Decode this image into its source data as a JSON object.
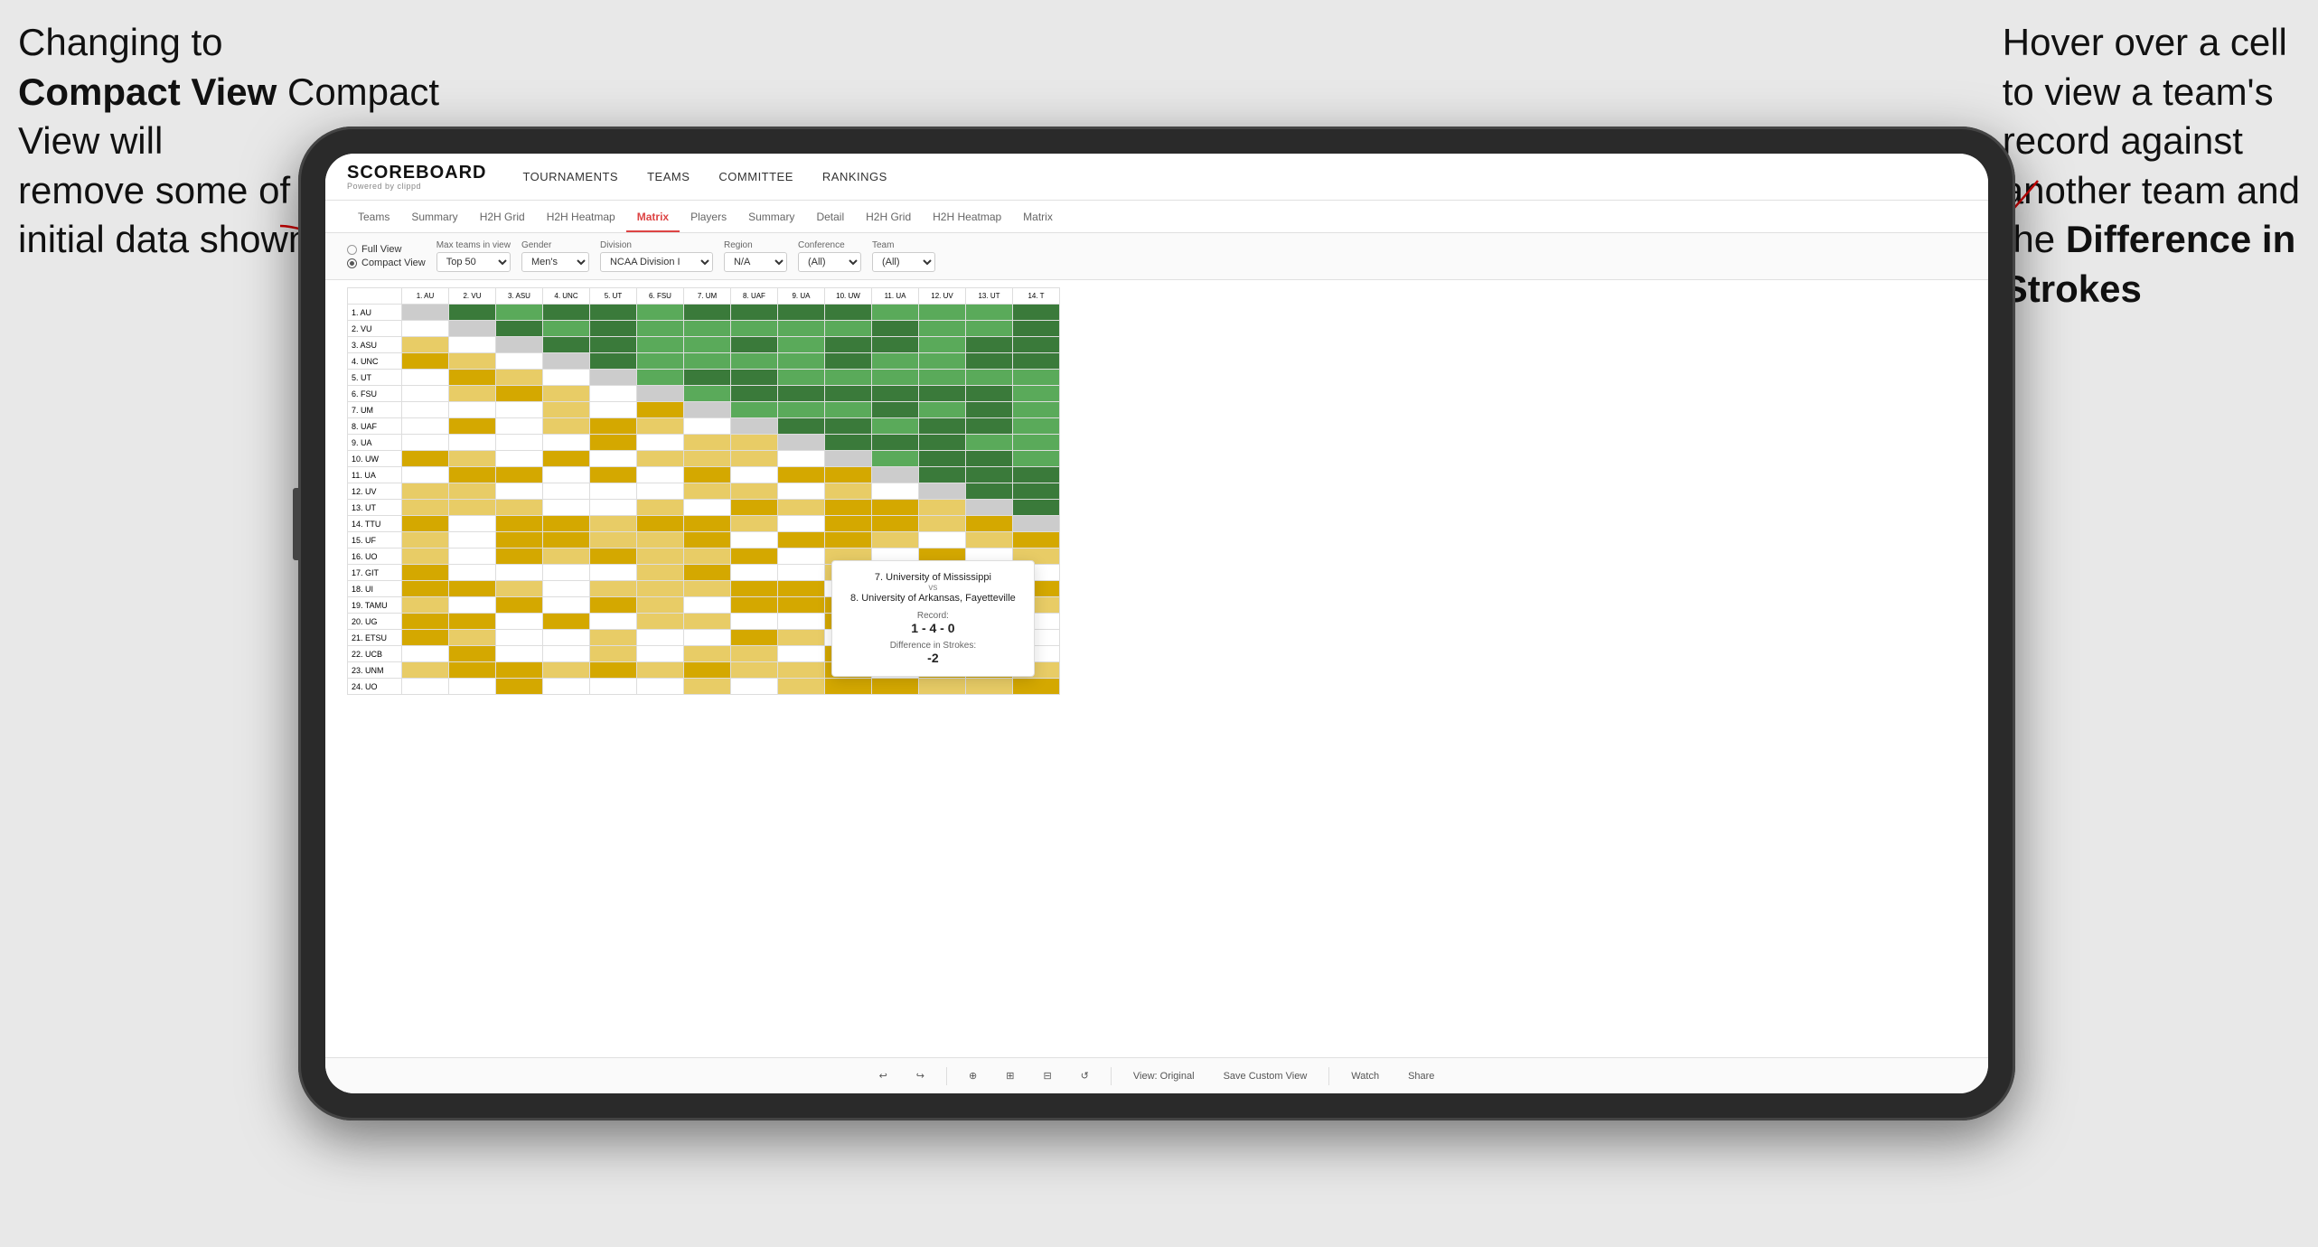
{
  "annotation_left": {
    "line1": "Changing to",
    "line2": "Compact View will",
    "line3": "remove some of the",
    "line4": "initial data shown"
  },
  "annotation_right": {
    "line1": "Hover over a cell",
    "line2": "to view a team's",
    "line3": "record against",
    "line4": "another team and",
    "line5": "the",
    "line6": "Difference in",
    "line7": "Strokes"
  },
  "app": {
    "logo": "SCOREBOARD",
    "logo_sub": "Powered by clippd",
    "nav": [
      "TOURNAMENTS",
      "TEAMS",
      "COMMITTEE",
      "RANKINGS"
    ],
    "sub_nav": [
      "Teams",
      "Summary",
      "H2H Grid",
      "H2H Heatmap",
      "Matrix",
      "Players",
      "Summary",
      "Detail",
      "H2H Grid",
      "H2H Heatmap",
      "Matrix"
    ],
    "active_tab": "Matrix"
  },
  "controls": {
    "view_full": "Full View",
    "view_compact": "Compact View",
    "max_teams_label": "Max teams in view",
    "max_teams_value": "Top 50",
    "gender_label": "Gender",
    "gender_value": "Men's",
    "division_label": "Division",
    "division_value": "NCAA Division I",
    "region_label": "Region",
    "region_value": "N/A",
    "conference_label": "Conference",
    "conference_value": "(All)",
    "team_label": "Team",
    "team_value": "(All)"
  },
  "col_headers": [
    "1. AU",
    "2. VU",
    "3. ASU",
    "4. UNC",
    "5. UT",
    "6. FSU",
    "7. UM",
    "8. UAF",
    "9. UA",
    "10. UW",
    "11. UA",
    "12. UV",
    "13. UT",
    "14. T"
  ],
  "rows": [
    {
      "label": "1. AU",
      "cells": [
        "x",
        "g",
        "g",
        "g",
        "g",
        "g",
        "g",
        "g",
        "g",
        "g",
        "g",
        "g",
        "g",
        "g"
      ]
    },
    {
      "label": "2. VU",
      "cells": [
        "y",
        "x",
        "g",
        "g",
        "g",
        "g",
        "g",
        "g",
        "g",
        "g",
        "g",
        "g",
        "g",
        "g"
      ]
    },
    {
      "label": "3. ASU",
      "cells": [
        "y",
        "y",
        "x",
        "g",
        "g",
        "y",
        "g",
        "g",
        "g",
        "g",
        "g",
        "g",
        "g",
        "g"
      ]
    },
    {
      "label": "4. UNC",
      "cells": [
        "y",
        "y",
        "y",
        "x",
        "g",
        "y",
        "g",
        "g",
        "g",
        "g",
        "g",
        "g",
        "g",
        "g"
      ]
    },
    {
      "label": "5. UT",
      "cells": [
        "y",
        "y",
        "y",
        "y",
        "x",
        "y",
        "y",
        "g",
        "g",
        "g",
        "g",
        "g",
        "g",
        "g"
      ]
    },
    {
      "label": "6. FSU",
      "cells": [
        "w",
        "y",
        "g",
        "g",
        "g",
        "x",
        "g",
        "g",
        "g",
        "g",
        "g",
        "g",
        "g",
        "g"
      ]
    },
    {
      "label": "7. UM",
      "cells": [
        "y",
        "y",
        "y",
        "y",
        "g",
        "y",
        "x",
        "y",
        "g",
        "g",
        "g",
        "g",
        "g",
        "g"
      ]
    },
    {
      "label": "8. UAF",
      "cells": [
        "y",
        "y",
        "y",
        "y",
        "y",
        "y",
        "g",
        "x",
        "g",
        "g",
        "g",
        "g",
        "g",
        "g"
      ]
    },
    {
      "label": "9. UA",
      "cells": [
        "y",
        "y",
        "y",
        "y",
        "y",
        "y",
        "y",
        "y",
        "x",
        "g",
        "g",
        "g",
        "g",
        "g"
      ]
    },
    {
      "label": "10. UW",
      "cells": [
        "w",
        "w",
        "y",
        "y",
        "y",
        "y",
        "y",
        "y",
        "g",
        "x",
        "g",
        "g",
        "g",
        "g"
      ]
    },
    {
      "label": "11. UA",
      "cells": [
        "w",
        "w",
        "y",
        "y",
        "y",
        "y",
        "y",
        "g",
        "g",
        "y",
        "x",
        "g",
        "g",
        "g"
      ]
    },
    {
      "label": "12. UV",
      "cells": [
        "y",
        "y",
        "y",
        "y",
        "y",
        "y",
        "y",
        "y",
        "g",
        "y",
        "y",
        "x",
        "g",
        "g"
      ]
    },
    {
      "label": "13. UT",
      "cells": [
        "y",
        "y",
        "y",
        "y",
        "y",
        "y",
        "y",
        "y",
        "g",
        "y",
        "y",
        "y",
        "x",
        "g"
      ]
    },
    {
      "label": "14. TTU",
      "cells": [
        "y",
        "y",
        "y",
        "y",
        "y",
        "y",
        "y",
        "y",
        "y",
        "y",
        "y",
        "y",
        "y",
        "x"
      ]
    },
    {
      "label": "15. UF",
      "cells": [
        "y",
        "y",
        "y",
        "y",
        "y",
        "g",
        "y",
        "y",
        "y",
        "y",
        "y",
        "y",
        "y",
        "y"
      ]
    },
    {
      "label": "16. UO",
      "cells": [
        "y",
        "y",
        "y",
        "y",
        "y",
        "y",
        "y",
        "y",
        "y",
        "y",
        "y",
        "y",
        "y",
        "y"
      ]
    },
    {
      "label": "17. GIT",
      "cells": [
        "y",
        "y",
        "y",
        "y",
        "y",
        "y",
        "y",
        "y",
        "y",
        "y",
        "y",
        "y",
        "y",
        "y"
      ]
    },
    {
      "label": "18. UI",
      "cells": [
        "y",
        "y",
        "y",
        "y",
        "y",
        "y",
        "y",
        "y",
        "y",
        "y",
        "y",
        "y",
        "y",
        "y"
      ]
    },
    {
      "label": "19. TAMU",
      "cells": [
        "y",
        "y",
        "y",
        "y",
        "y",
        "y",
        "y",
        "y",
        "y",
        "y",
        "y",
        "y",
        "y",
        "y"
      ]
    },
    {
      "label": "20. UG",
      "cells": [
        "g",
        "g",
        "g",
        "g",
        "g",
        "g",
        "g",
        "g",
        "g",
        "g",
        "g",
        "g",
        "g",
        "g"
      ]
    },
    {
      "label": "21. ETSU",
      "cells": [
        "y",
        "y",
        "y",
        "y",
        "g",
        "y",
        "g",
        "g",
        "g",
        "g",
        "y",
        "y",
        "y",
        "y"
      ]
    },
    {
      "label": "22. UCB",
      "cells": [
        "y",
        "y",
        "y",
        "y",
        "y",
        "y",
        "y",
        "y",
        "y",
        "y",
        "y",
        "y",
        "y",
        "y"
      ]
    },
    {
      "label": "23. UNM",
      "cells": [
        "g",
        "g",
        "g",
        "g",
        "g",
        "g",
        "g",
        "g",
        "g",
        "g",
        "g",
        "g",
        "g",
        "g"
      ]
    },
    {
      "label": "24. UO",
      "cells": [
        "y",
        "y",
        "g",
        "g",
        "g",
        "g",
        "g",
        "g",
        "g",
        "g",
        "g",
        "g",
        "g",
        "g"
      ]
    }
  ],
  "tooltip": {
    "team1": "7. University of Mississippi",
    "vs": "vs",
    "team2": "8. University of Arkansas, Fayetteville",
    "record_label": "Record:",
    "record_value": "1 - 4 - 0",
    "strokes_label": "Difference in Strokes:",
    "strokes_value": "-2"
  },
  "toolbar": {
    "undo": "↩",
    "redo": "↪",
    "view_original": "View: Original",
    "save_custom": "Save Custom View",
    "watch": "Watch",
    "share": "Share"
  }
}
